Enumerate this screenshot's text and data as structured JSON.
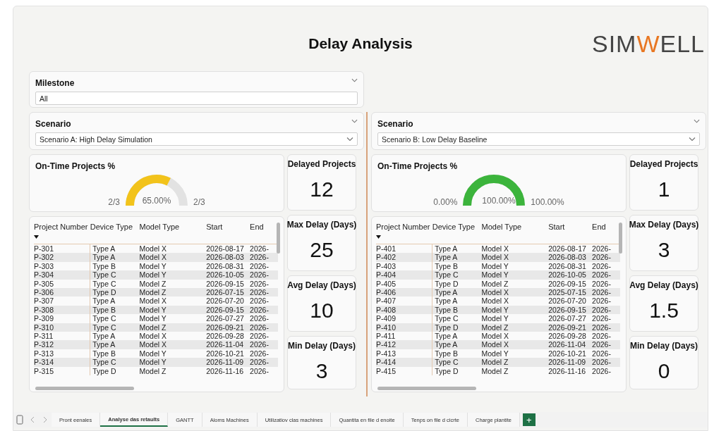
{
  "title": "Delay Analysis",
  "logo": [
    {
      "text": "SIM",
      "accent": false
    },
    {
      "text": "W",
      "accent": true
    },
    {
      "text": "ELL",
      "accent": false
    }
  ],
  "milestone": {
    "label": "Milestone",
    "value": "All"
  },
  "panels": [
    {
      "scenario": {
        "label": "Scenario",
        "value": "Scenario A: High Delay Simulation"
      },
      "gauge": {
        "title": "On-Time Projects %",
        "value": "65.00%",
        "min": "2/3",
        "max": "2/3",
        "color": "#f2c31b"
      },
      "kpis": [
        {
          "label": "Delayed Projects",
          "value": "12"
        },
        {
          "label": "Max Delay (Days)",
          "value": "25"
        },
        {
          "label": "Avg Delay (Days)",
          "value": "10"
        },
        {
          "label": "Min Delay (Days)",
          "value": "3"
        }
      ],
      "table": {
        "columns": [
          "Project Number",
          "Device Type",
          "Model Type",
          "Start",
          "End"
        ],
        "rows": [
          [
            "P-301",
            "Type A",
            "Model X",
            "2026-08-17",
            "2026-"
          ],
          [
            "P-302",
            "Type A",
            "Model X",
            "2026-08-03",
            "2026-"
          ],
          [
            "P-303",
            "Type B",
            "Model Y",
            "2026-08-31",
            "2026-"
          ],
          [
            "P-304",
            "Type C",
            "Model Y",
            "2026-10-05",
            "2026-"
          ],
          [
            "P-305",
            "Type C",
            "Model Z",
            "2026-09-15",
            "2026-"
          ],
          [
            "P-306",
            "Type D",
            "Model Z",
            "2026-07-15",
            "2026-"
          ],
          [
            "P-307",
            "Type A",
            "Model X",
            "2026-07-20",
            "2026-"
          ],
          [
            "P-308",
            "Type B",
            "Model Y",
            "2026-09-15",
            "2026-"
          ],
          [
            "P-309",
            "Type C",
            "Model Y",
            "2026-07-27",
            "2026-"
          ],
          [
            "P-310",
            "Type C",
            "Model Z",
            "2026-09-21",
            "2026-"
          ],
          [
            "P-311",
            "Type A",
            "Model X",
            "2026-09-28",
            "2026-"
          ],
          [
            "P-312",
            "Type A",
            "Model X",
            "2026-11-04",
            "2026-"
          ],
          [
            "P-313",
            "Type B",
            "Model Y",
            "2026-10-21",
            "2026-"
          ],
          [
            "P-314",
            "Type C",
            "Model Y",
            "2026-11-09",
            "2026-"
          ],
          [
            "P-315",
            "Type D",
            "Model Z",
            "2026-11-16",
            "2026-"
          ]
        ]
      }
    },
    {
      "scenario": {
        "label": "Scenario",
        "value": "Scenario B: Low Delay Baseline"
      },
      "gauge": {
        "title": "On-Time Projects %",
        "value": "100.00%",
        "min": "0.00%",
        "max": "100.00%",
        "color": "#3cb43c"
      },
      "kpis": [
        {
          "label": "Delayed Projects",
          "value": "1"
        },
        {
          "label": "Max Delay (Days)",
          "value": "3"
        },
        {
          "label": "Avg Delay (Days)",
          "value": "1.5"
        },
        {
          "label": "Min Delay (Days)",
          "value": "0"
        }
      ],
      "table": {
        "columns": [
          "Project Number",
          "Device Type",
          "Model Type",
          "Start",
          "End"
        ],
        "rows": [
          [
            "P-401",
            "Type A",
            "Model X",
            "2026-08-17",
            "2026-"
          ],
          [
            "P-402",
            "Type A",
            "Model X",
            "2026-08-03",
            "2026-"
          ],
          [
            "P-403",
            "Type B",
            "Model Y",
            "2026-08-31",
            "2026-"
          ],
          [
            "P-404",
            "Type C",
            "Model Y",
            "2026-10-05",
            "2026-"
          ],
          [
            "P-405",
            "Type D",
            "Model Z",
            "2026-09-15",
            "2026-"
          ],
          [
            "P-406",
            "Type A",
            "Model X",
            "2025-07-15",
            "2026-"
          ],
          [
            "P-407",
            "Type A",
            "Model X",
            "2026-07-20",
            "2026-"
          ],
          [
            "P-408",
            "Type B",
            "Model Y",
            "2026-09-15",
            "2026-"
          ],
          [
            "P-409",
            "Type C",
            "Model Y",
            "2026-07-27",
            "2026-"
          ],
          [
            "P-410",
            "Type D",
            "Model Z",
            "2026-09-21",
            "2026-"
          ],
          [
            "P-411",
            "Type A",
            "Model X",
            "2026-09-28",
            "2026-"
          ],
          [
            "P-412",
            "Type A",
            "Model X",
            "2026-11-04",
            "2026-"
          ],
          [
            "P-413",
            "Type B",
            "Model Y",
            "2026-10-21",
            "2026-"
          ],
          [
            "P-414",
            "Type C",
            "Model Z",
            "2026-11-09",
            "2026-"
          ],
          [
            "P-415",
            "Type D",
            "Model Z",
            "2026-11-16",
            "2026-"
          ]
        ]
      }
    }
  ],
  "pages": [
    {
      "label": "Pront eenales",
      "selected": false
    },
    {
      "label": "Analyse das retaults",
      "selected": true
    },
    {
      "label": "GANTT",
      "selected": false
    },
    {
      "label": "Aloms Machines",
      "selected": false
    },
    {
      "label": "Utilizatiov clas machines",
      "selected": false
    },
    {
      "label": "Quantita en file d enoite",
      "selected": false
    },
    {
      "label": "Tenps on file d cicrte",
      "selected": false
    },
    {
      "label": "Charge plantite",
      "selected": false
    }
  ],
  "add_page": "+"
}
